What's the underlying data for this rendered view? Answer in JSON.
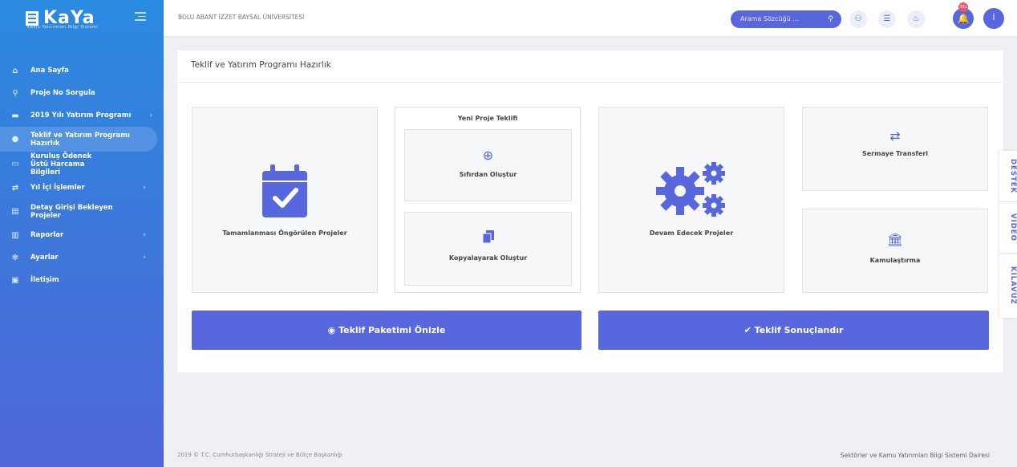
{
  "sidebar": {
    "logo_text": "KaYa",
    "logo_sub": "Kamu Yatırımları Bilgi Sistemi",
    "items": [
      {
        "label": "Ana Sayfa",
        "icon": "home-icon"
      },
      {
        "label": "Proje No Sorgula",
        "icon": "search-icon"
      },
      {
        "label": "2019 Yılı Yatırım Programı",
        "icon": "folder-icon"
      },
      {
        "label": "Teklif ve Yatırım Programı Hazırlık",
        "icon": "users-icon"
      },
      {
        "label": "Kuruluş Ödenek Üstü Harcama Bilgileri",
        "icon": "card-icon"
      },
      {
        "label": "Yıl İçi İşlemler",
        "icon": "exchange-icon"
      },
      {
        "label": "Detay Girişi Bekleyen Projeler",
        "icon": "list-icon"
      },
      {
        "label": "Raporlar",
        "icon": "chart-icon"
      },
      {
        "label": "Ayarlar",
        "icon": "gear-icon"
      },
      {
        "label": "İletişim",
        "icon": "contact-icon"
      }
    ]
  },
  "header": {
    "university": "BOLU ABANT İZZET BAYSAL ÜNİVERSİTESİ",
    "search_placeholder": "Arama Sözcüğü ...",
    "notification_count": "301",
    "user_initial": "İ"
  },
  "card": {
    "title": "Teklif ve Yatırım Programı Hazırlık",
    "tiles": {
      "tamamlanmasi": "Tamamlanması Öngörülen Projeler",
      "yeni_proje": "Yeni Proje Teklifi",
      "sifirdan": "Sıfırdan Oluştur",
      "kopyalayarak": "Kopyalayarak Oluştur",
      "devam": "Devam Edecek Projeler",
      "sermaye": "Sermaye Transferi",
      "kamulastirma": "Kamulaştırma"
    },
    "buttons": {
      "onizle": "Teklif Paketimi Önizle",
      "sonuclandir": "Teklif Sonuçlandır"
    }
  },
  "footer": {
    "left": "2019 © T.C. Cumhurbaşkanlığı Strateji ve Bütçe Başkanlığı",
    "right": "Sektörler ve Kamu Yatırımları Bilgi Sistemi Dairesi"
  },
  "right_tabs": [
    "DESTEK",
    "VİDEO",
    "KILAVUZ"
  ],
  "colors": {
    "accent": "#5867dd",
    "sidebar_top": "#2a8ae0",
    "sidebar_bottom": "#4f66d6"
  }
}
